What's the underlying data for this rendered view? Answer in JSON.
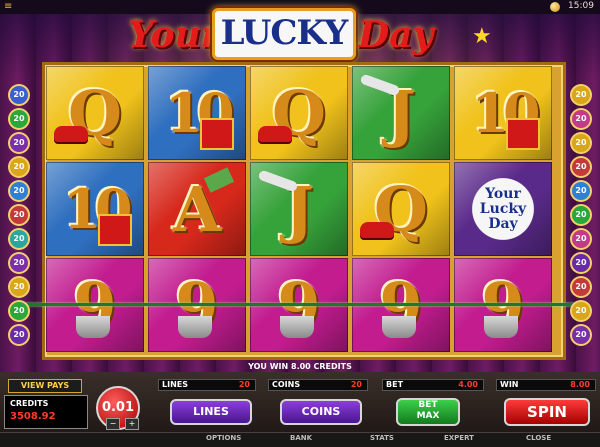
{
  "topbar": {
    "clock": "15:09",
    "menu_icon": "menu-icon",
    "coin_icon": "coin-icon"
  },
  "logo": {
    "part1": "Your",
    "part2": "LUCKY",
    "part3": "Day"
  },
  "reels": [
    [
      "Q",
      "10",
      "A",
      "J"
    ],
    [
      "10",
      "A",
      "Q",
      "J"
    ],
    [
      "Q",
      "J",
      "10",
      "logo"
    ],
    [
      "9",
      "9",
      "9",
      "9",
      "9"
    ]
  ],
  "reel_grid": [
    [
      "Q",
      "10",
      "Q",
      "J",
      "10"
    ],
    [
      "10",
      "A",
      "J",
      "Q",
      "Your Lucky Day"
    ],
    [
      "9",
      "9",
      "9",
      "9",
      "9"
    ]
  ],
  "lines_left": [
    "20",
    "20",
    "20",
    "20",
    "20",
    "20",
    "20",
    "20",
    "20",
    "20",
    "20"
  ],
  "lines_right": [
    "20",
    "20",
    "20",
    "20",
    "20",
    "20",
    "20",
    "20",
    "20",
    "20",
    "20"
  ],
  "status": {
    "win_message": "YOU WIN 8.00 CREDITS"
  },
  "panel": {
    "view_pays": "VIEW PAYS",
    "credits_label": "CREDITS",
    "credits_value": "3508.92",
    "coin_size": "0.01",
    "coin_minus": "−",
    "coin_plus": "+",
    "lines_label": "LINES",
    "lines_value": "20",
    "coins_label": "COINS",
    "coins_value": "20",
    "bet_label": "BET",
    "bet_value": "4.00",
    "win_label": "WIN",
    "win_value": "8.00",
    "btn_lines": "LINES",
    "btn_coins": "COINS",
    "btn_betmax_1": "BET",
    "btn_betmax_2": "MAX",
    "btn_spin": "SPIN"
  },
  "footer": {
    "options": "OPTIONS",
    "bank": "BANK",
    "stats": "STATS",
    "expert": "EXPERT",
    "close": "CLOSE"
  },
  "colors": {
    "reel_yellow": "#f0c21b",
    "reel_blue": "#2f6fbf",
    "reel_red": "#d6281b",
    "reel_green": "#36a23a",
    "reel_magenta": "#c21c8f",
    "spin_red": "#e31b1b",
    "betmax_green": "#2bbf3a"
  }
}
